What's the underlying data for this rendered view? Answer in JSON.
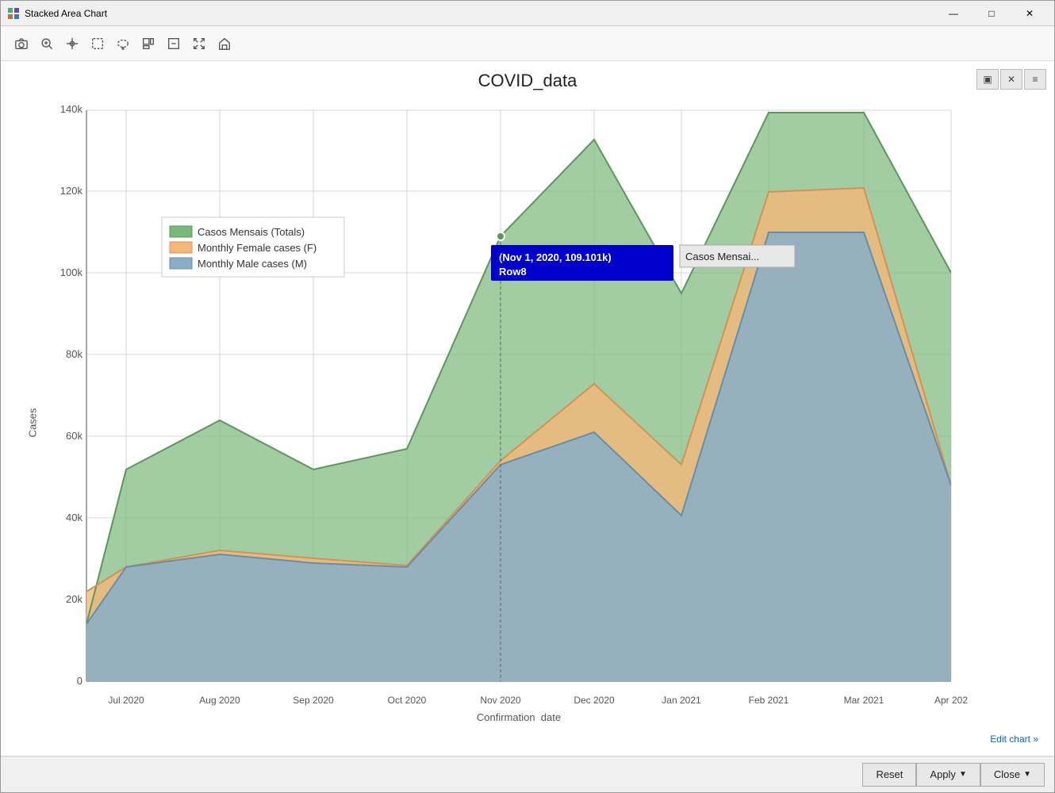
{
  "window": {
    "title": "Stacked Area Chart",
    "minimize_label": "—",
    "maximize_label": "□",
    "close_label": "✕"
  },
  "toolbar": {
    "tools": [
      {
        "name": "camera-icon",
        "icon": "📷",
        "label": "Save"
      },
      {
        "name": "zoom-icon",
        "icon": "🔍",
        "label": "Zoom"
      },
      {
        "name": "crosshair-icon",
        "icon": "+",
        "label": "Crosshair"
      },
      {
        "name": "select-icon",
        "icon": "⬚",
        "label": "Select"
      },
      {
        "name": "lasso-icon",
        "icon": "◯",
        "label": "Lasso"
      },
      {
        "name": "zoom-in-icon",
        "icon": "＋",
        "label": "Zoom In"
      },
      {
        "name": "zoom-out-icon",
        "icon": "－",
        "label": "Zoom Out"
      },
      {
        "name": "zoom-fit-icon",
        "icon": "⛶",
        "label": "Zoom Fit"
      },
      {
        "name": "home-icon",
        "icon": "⌂",
        "label": "Home"
      }
    ]
  },
  "chart": {
    "title": "COVID_data",
    "y_axis_label": "Cases",
    "x_axis_label": "Confirmation_date",
    "top_controls": [
      "▣",
      "✕",
      "≡"
    ],
    "legend": [
      {
        "label": "Casos Mensais (Totals)",
        "color": "#7ab87a",
        "border_color": "#5a985a"
      },
      {
        "label": "Monthly Female cases (F)",
        "color": "#f5b87a",
        "border_color": "#d89050"
      },
      {
        "label": "Monthly Male cases (M)",
        "color": "#8aaec8",
        "border_color": "#6090b0"
      }
    ],
    "x_labels": [
      "Jul 2020",
      "Aug 2020",
      "Sep 2020",
      "Oct 2020",
      "Nov 2020",
      "Dec 2020",
      "Jan 2021",
      "Feb 2021",
      "Mar 2021",
      "Apr 202"
    ],
    "y_labels": [
      "0",
      "20k",
      "40k",
      "60k",
      "80k",
      "100k",
      "120k",
      "140k"
    ],
    "tooltip": {
      "text_line1": "(Nov 1, 2020, 109.101k)",
      "text_line2": "Row8",
      "bg_color": "#0000cc"
    },
    "tooltip_label": "Casos Mensai...",
    "edit_chart_link": "Edit chart »"
  },
  "bottom_bar": {
    "reset_label": "Reset",
    "apply_label": "Apply",
    "close_label": "Close"
  }
}
